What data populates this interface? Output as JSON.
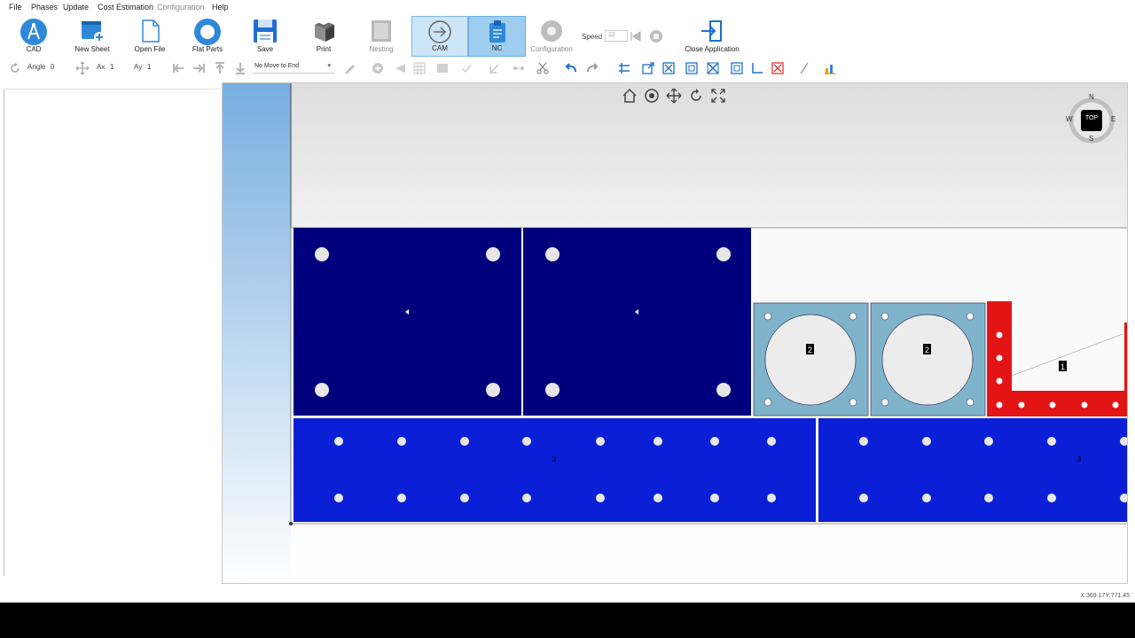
{
  "menu": {
    "items": [
      "File",
      "Phases",
      "Update",
      "Cost Estimation",
      "Configuration",
      "Help"
    ]
  },
  "ribbon": {
    "cad": "CAD",
    "new_sheet": "New Sheet",
    "open_file": "Open File",
    "flat_parts": "Flat Parts",
    "save": "Save",
    "print": "Print",
    "nesting": "Nesting",
    "cam": "CAM",
    "nc": "NC",
    "configuration": "Configuration",
    "speed_label": "Speed",
    "speed_value": "12",
    "close_application": "Close Application"
  },
  "toolbar": {
    "angle_label": "Angle",
    "angle_value": "0",
    "ax_label": "Ax",
    "ax_value": "1",
    "ay_label": "Ay",
    "ay_value": "1",
    "move_select": "No Move to End"
  },
  "compass": {
    "n": "N",
    "s": "S",
    "e": "E",
    "w": "W",
    "center": "TOP"
  },
  "parts": {
    "circle_label": "2",
    "red_label": "1",
    "blue_label": "3"
  },
  "status": {
    "coords": "X:369.17Y:771.45"
  },
  "colors": {
    "navy": "#00007e",
    "blue": "#0b1fd6",
    "lightblue": "#7fb3cc",
    "red": "#e31414",
    "accent": "#2f88d9"
  }
}
